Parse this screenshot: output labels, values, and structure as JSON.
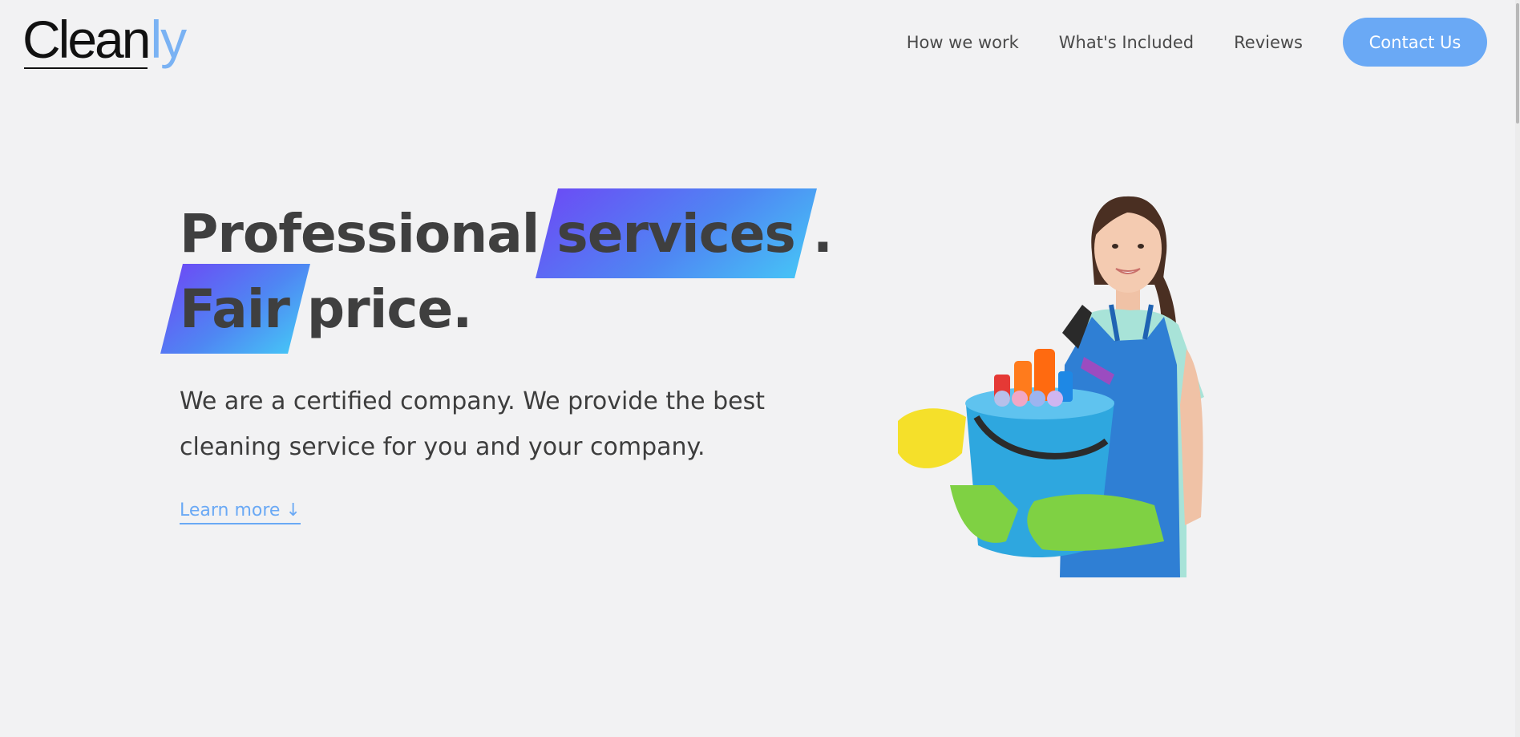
{
  "brand": {
    "logo_main": "Clean",
    "logo_accent": "ly"
  },
  "nav": {
    "items": [
      {
        "label": "How we work"
      },
      {
        "label": "What's Included"
      },
      {
        "label": "Reviews"
      }
    ],
    "cta_label": "Contact Us"
  },
  "hero": {
    "headline": {
      "part1": "Professional",
      "highlight1": "services",
      "period1": ".",
      "highlight2": "Fair",
      "part2": "price."
    },
    "lead": "We are a certified company. We provide the best cleaning service for you and your company.",
    "learn_more": "Learn more ↓",
    "image_icon": "cleaning-woman-illustration"
  },
  "colors": {
    "accent": "#6aa9f5",
    "gradient_start": "#6a4ef5",
    "gradient_end": "#46c2f6",
    "background": "#f2f2f3",
    "text": "#3d3d3d"
  }
}
